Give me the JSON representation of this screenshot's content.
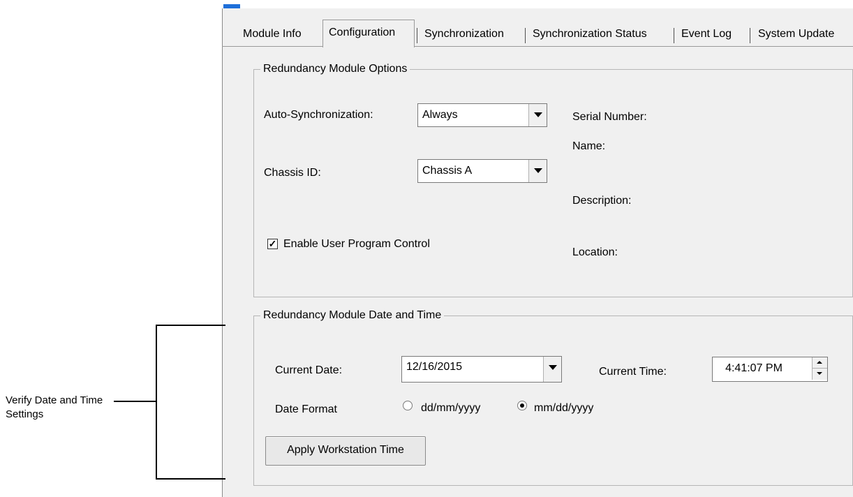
{
  "tabs": [
    {
      "label": "Module Info",
      "selected": false
    },
    {
      "label": "Configuration",
      "selected": true
    },
    {
      "label": "Synchronization",
      "selected": false
    },
    {
      "label": "Synchronization Status",
      "selected": false
    },
    {
      "label": "Event Log",
      "selected": false
    },
    {
      "label": "System Update",
      "selected": false
    }
  ],
  "options": {
    "legend": "Redundancy Module Options",
    "auto_sync_label": "Auto-Synchronization:",
    "auto_sync_value": "Always",
    "chassis_label": "Chassis ID:",
    "chassis_value": "Chassis A",
    "enable_label": "Enable User Program Control",
    "enable_checked": true,
    "serial_label": "Serial Number:",
    "name_label": "Name:",
    "description_label": "Description:",
    "location_label": "Location:"
  },
  "datetime": {
    "legend": "Redundancy Module Date and Time",
    "current_date_label": "Current Date:",
    "current_date_value": "12/16/2015",
    "current_time_label": "Current Time:",
    "current_time_value": "4:41:07 PM",
    "date_format_label": "Date Format",
    "format_options": [
      "dd/mm/yyyy",
      "mm/dd/yyyy"
    ],
    "selected_format": "mm/dd/yyyy",
    "apply_button": "Apply Workstation Time"
  },
  "annotation": {
    "line1": "Verify Date and Time",
    "line2": "Settings"
  },
  "colors": {
    "dialog_bg": "#f0f0f0",
    "accent": "#1e6fd9"
  }
}
